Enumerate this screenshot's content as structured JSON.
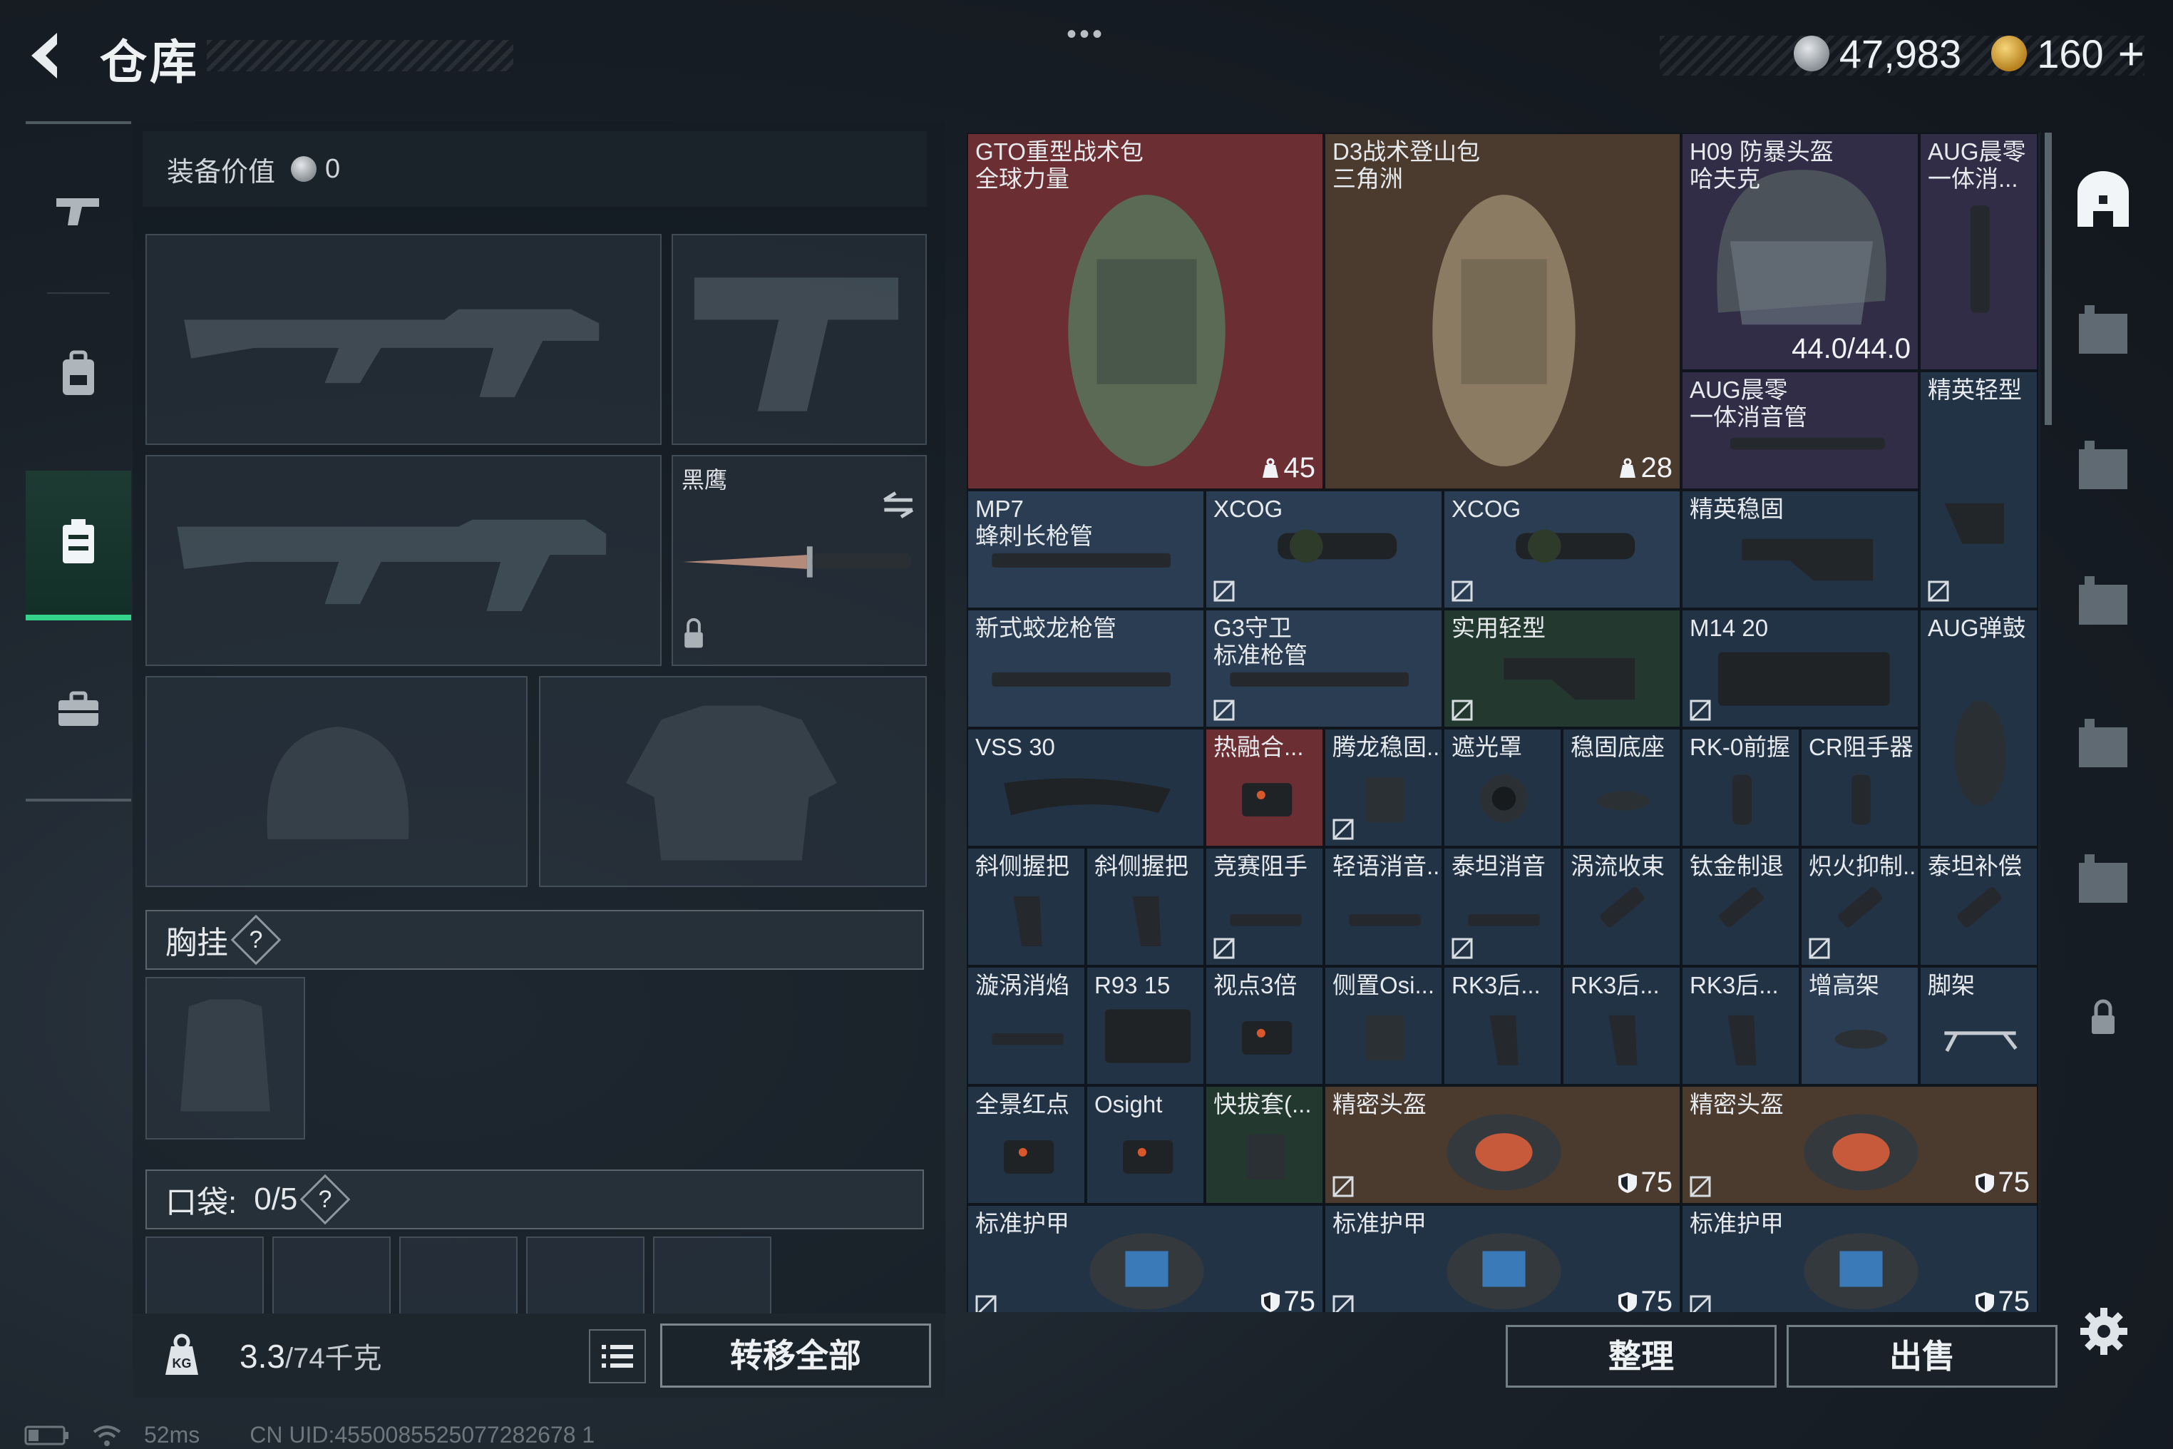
{
  "header": {
    "title": "仓库",
    "more": "•••",
    "currency_silver": "47,983",
    "currency_gold": "160",
    "add": "+"
  },
  "side_nav": {
    "items": [
      "weapons-icon",
      "backpack-icon",
      "gear-icon",
      "briefcase-icon"
    ],
    "active": 2
  },
  "loadout": {
    "equipment_value_label": "装备价值",
    "equipment_value": "0",
    "melee_name": "黑鹰",
    "chest_rig_label": "胸挂",
    "help": "?",
    "pocket_label": "口袋:",
    "pocket_count": "0/5"
  },
  "footer": {
    "weight_current": "3.3",
    "weight_max": "/74千克",
    "transfer_all": "转移全部",
    "sort": "整理",
    "sell": "出售"
  },
  "status": {
    "ping": "52ms",
    "uid": "CN UID:4550085525077282678 1"
  },
  "stash": {
    "items": [
      {
        "name": "GTO重型战术包\n全球力量",
        "badge": "45"
      },
      {
        "name": "D3战术登山包\n三角洲",
        "badge": "28"
      },
      {
        "name": "H09 防暴头盔\n哈夫克",
        "badge": "44.0/44.0"
      },
      {
        "name": "AUG晨零\n一体消...",
        "badge": ""
      },
      {
        "name": "AUG晨零\n一体消音管",
        "badge": ""
      },
      {
        "name": "精英轻型",
        "badge": ""
      },
      {
        "name": "MP7\n蜂刺长枪管",
        "badge": ""
      },
      {
        "name": "XCOG",
        "badge": ""
      },
      {
        "name": "XCOG",
        "badge": ""
      },
      {
        "name": "精英稳固",
        "badge": ""
      },
      {
        "name": "新式蛟龙枪管",
        "badge": ""
      },
      {
        "name": "G3守卫\n标准枪管",
        "badge": ""
      },
      {
        "name": "实用轻型",
        "badge": ""
      },
      {
        "name": "M14 20",
        "badge": ""
      },
      {
        "name": "AUG弹鼓",
        "badge": ""
      },
      {
        "name": "VSS 30",
        "badge": ""
      },
      {
        "name": "热融合...",
        "badge": ""
      },
      {
        "name": "腾龙稳固...",
        "badge": ""
      },
      {
        "name": "遮光罩",
        "badge": ""
      },
      {
        "name": "稳固底座",
        "badge": ""
      },
      {
        "name": "RK-0前握",
        "badge": ""
      },
      {
        "name": "CR阻手器",
        "badge": ""
      },
      {
        "name": "斜侧握把",
        "badge": ""
      },
      {
        "name": "斜侧握把",
        "badge": ""
      },
      {
        "name": "竞赛阻手",
        "badge": ""
      },
      {
        "name": "轻语消音...",
        "badge": ""
      },
      {
        "name": "泰坦消音",
        "badge": ""
      },
      {
        "name": "涡流收束",
        "badge": ""
      },
      {
        "name": "钛金制退",
        "badge": ""
      },
      {
        "name": "炽火抑制...",
        "badge": ""
      },
      {
        "name": "泰坦补偿",
        "badge": ""
      },
      {
        "name": "漩涡消焰",
        "badge": ""
      },
      {
        "name": "R93 15",
        "badge": ""
      },
      {
        "name": "视点3倍",
        "badge": ""
      },
      {
        "name": "侧置Osi...",
        "badge": ""
      },
      {
        "name": "RK3后...",
        "badge": ""
      },
      {
        "name": "RK3后...",
        "badge": ""
      },
      {
        "name": "RK3后...",
        "badge": ""
      },
      {
        "name": "增高架",
        "badge": ""
      },
      {
        "name": "脚架",
        "badge": ""
      },
      {
        "name": "全景红点",
        "badge": ""
      },
      {
        "name": "Osight",
        "badge": ""
      },
      {
        "name": "快拔套(...",
        "badge": ""
      },
      {
        "name": "精密头盔",
        "badge": "75"
      },
      {
        "name": "精密头盔",
        "badge": "75"
      },
      {
        "name": "标准护甲",
        "badge": "75"
      },
      {
        "name": "标准护甲",
        "badge": "75"
      },
      {
        "name": "标准护甲",
        "badge": "75"
      }
    ]
  },
  "colors": {
    "accent_green": "#35d48c",
    "rarity_red": "#6b2e32",
    "rarity_brown": "#4b3a2e",
    "rarity_blue": "#2a3d52",
    "rarity_green": "#23392f",
    "rarity_purple": "#312d47"
  }
}
